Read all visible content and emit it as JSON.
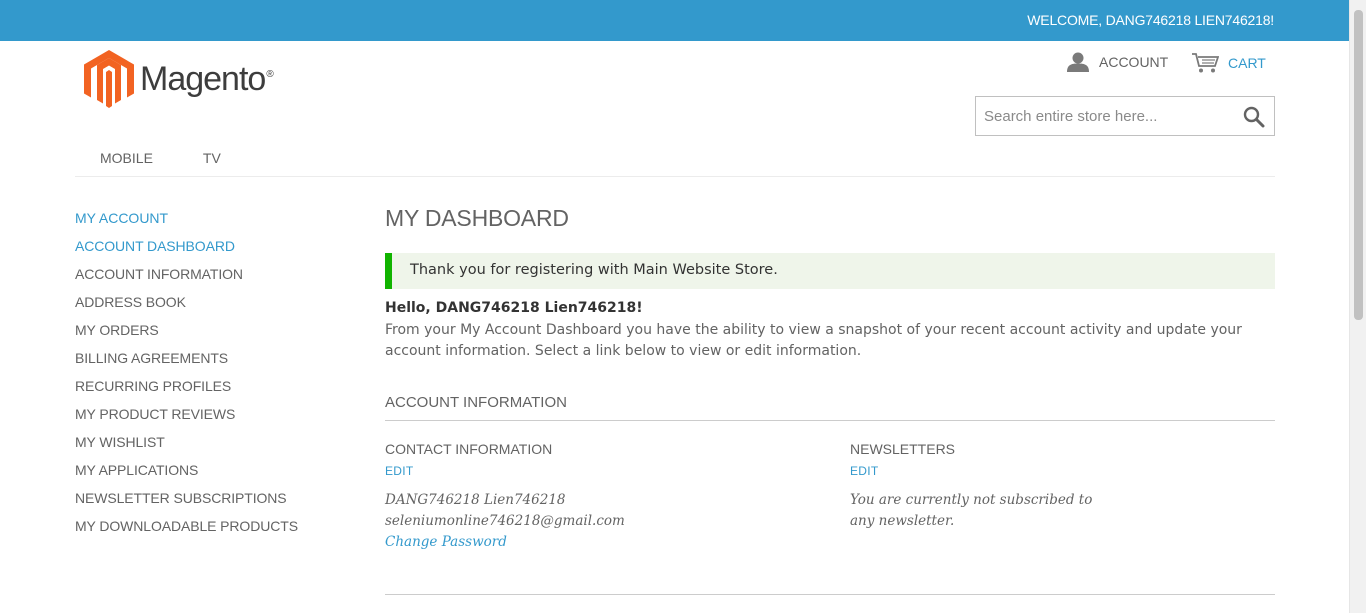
{
  "header": {
    "welcome": "WELCOME, DANG746218 LIEN746218!",
    "logo_text": "Magento",
    "logo_reg": "®",
    "account_label": "ACCOUNT",
    "cart_label": "CART",
    "search_placeholder": "Search entire store here..."
  },
  "nav": {
    "items": [
      "MOBILE",
      "TV"
    ]
  },
  "sidebar": {
    "title": "MY ACCOUNT",
    "items": [
      "ACCOUNT DASHBOARD",
      "ACCOUNT INFORMATION",
      "ADDRESS BOOK",
      "MY ORDERS",
      "BILLING AGREEMENTS",
      "RECURRING PROFILES",
      "MY PRODUCT REVIEWS",
      "MY WISHLIST",
      "MY APPLICATIONS",
      "NEWSLETTER SUBSCRIPTIONS",
      "MY DOWNLOADABLE PRODUCTS"
    ]
  },
  "main": {
    "title": "MY DASHBOARD",
    "success_message": "Thank you for registering with Main Website Store.",
    "hello": "Hello, DANG746218 Lien746218!",
    "intro": "From your My Account Dashboard you have the ability to view a snapshot of your recent account activity and update your account information. Select a link below to view or edit information.",
    "section_title": "ACCOUNT INFORMATION",
    "contact": {
      "title": "CONTACT INFORMATION",
      "edit": "EDIT",
      "name": "DANG746218 Lien746218",
      "email": "seleniumonline746218@gmail.com",
      "change_password": "Change Password"
    },
    "newsletters": {
      "title": "NEWSLETTERS",
      "edit": "EDIT",
      "text": "You are currently not subscribed to any newsletter."
    }
  },
  "colors": {
    "accent": "#3399cc",
    "success": "#11b400",
    "logo_orange": "#f26322"
  }
}
